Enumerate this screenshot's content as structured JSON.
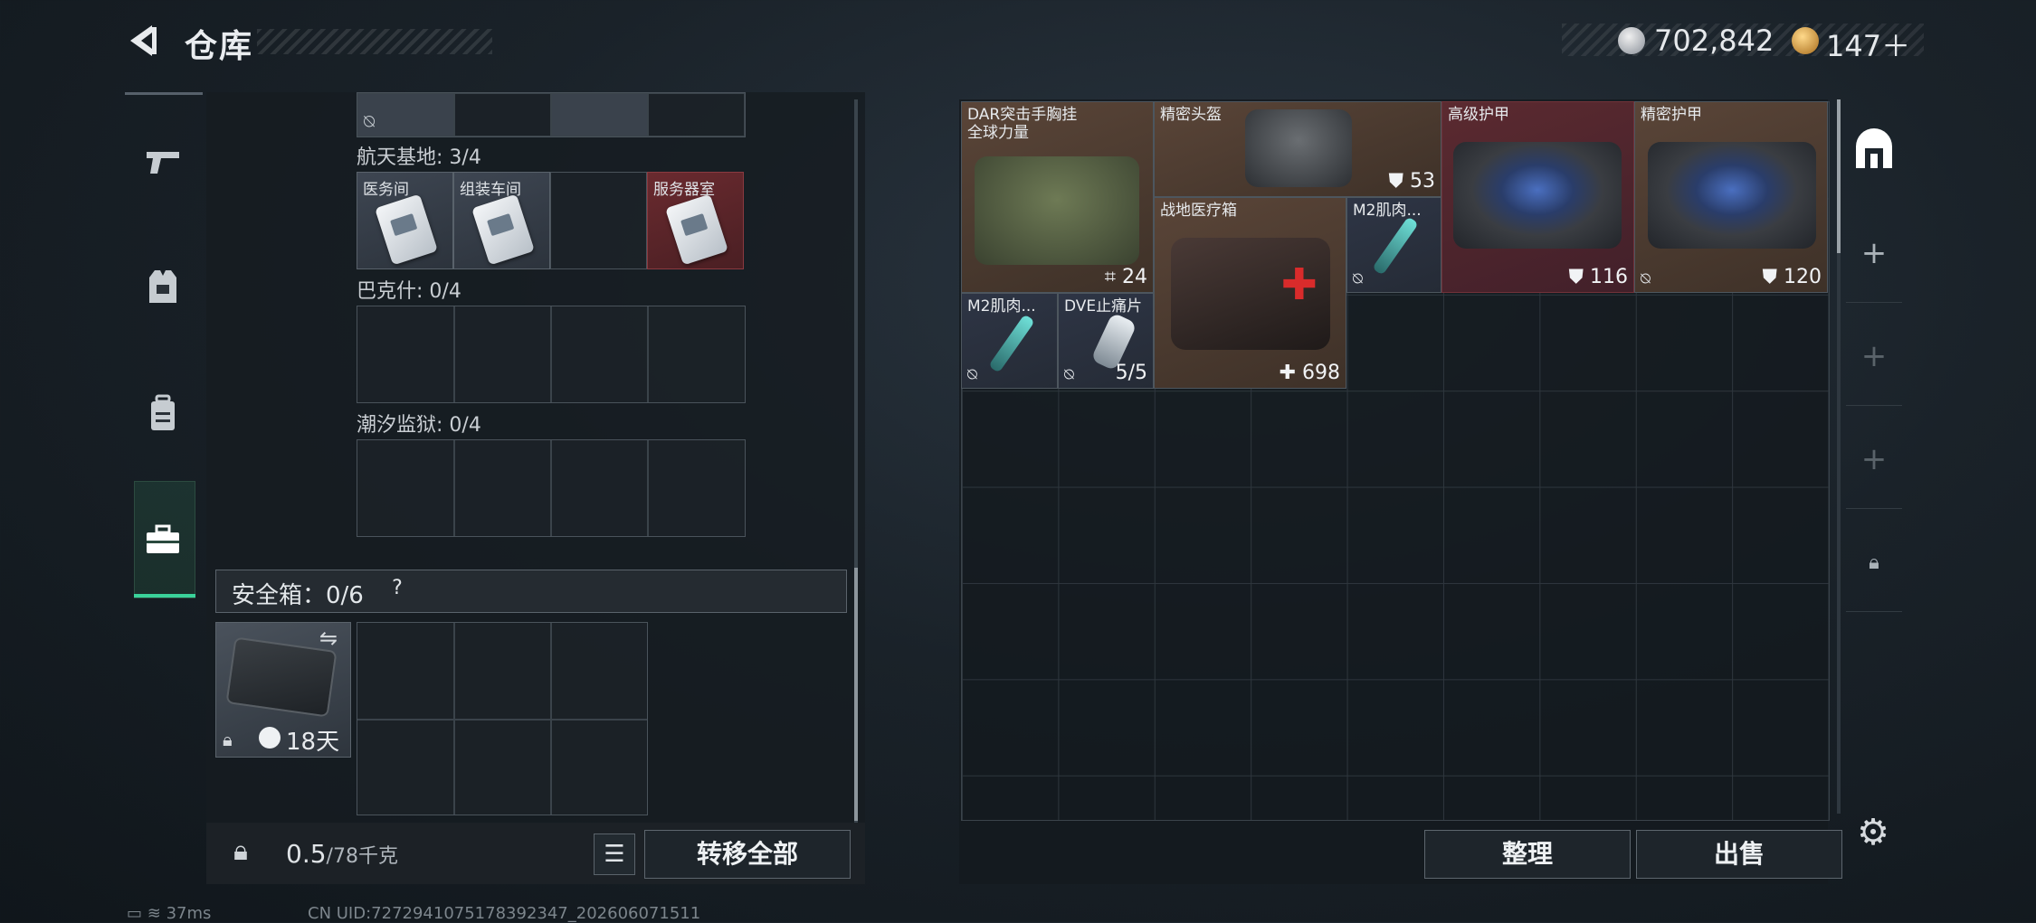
{
  "header": {
    "title": "仓库"
  },
  "currency": {
    "coins": "702,842",
    "tokens": "147＋"
  },
  "left": {
    "sections": {
      "s1": {
        "label": "航天基地: 3/4",
        "cards": [
          "医务间",
          "组装车间",
          "服务器室"
        ]
      },
      "s2": {
        "label": "巴克什: 0/4"
      },
      "s3": {
        "label": "潮汐监狱: 0/4"
      }
    },
    "safe_box": {
      "label": "安全箱：0/6",
      "help": "?",
      "days": "18天"
    },
    "weight": {
      "value": "0.5",
      "max": "/78千克"
    },
    "transfer_label": "转移全部"
  },
  "stash": {
    "items": [
      {
        "name": "DAR突击手胸挂\n全球力量",
        "stat": "24"
      },
      {
        "name": "精密头盔",
        "stat": "53"
      },
      {
        "name": "高级护甲",
        "stat": "116"
      },
      {
        "name": "精密护甲",
        "stat": "120"
      },
      {
        "name": "战地医疗箱",
        "stat": "698"
      },
      {
        "name": "M2肌肉..."
      },
      {
        "name": "M2肌肉..."
      },
      {
        "name": "DVE止痛片",
        "stat": "5/5"
      }
    ]
  },
  "buttons": {
    "sort": "整理",
    "sell": "出售"
  },
  "status_bar": {
    "ping": "37ms",
    "uid": "CN UID:7272941075178392347_202606071511"
  },
  "icons": [
    "back-arrow-icon",
    "coin-icon",
    "token-icon",
    "pistol-icon",
    "vest-icon",
    "backpack-icon",
    "toolbox-icon",
    "lock-icon",
    "list-icon",
    "swap-icon",
    "clock-icon",
    "armor-icon",
    "helmet-icon",
    "plus-icon",
    "gear-icon",
    "battery-icon",
    "wifi-icon",
    "no-sell-icon"
  ],
  "colors": {
    "accent": "#3ad29a",
    "red_item": "#5b2a30",
    "brown_item": "#5a4538"
  }
}
